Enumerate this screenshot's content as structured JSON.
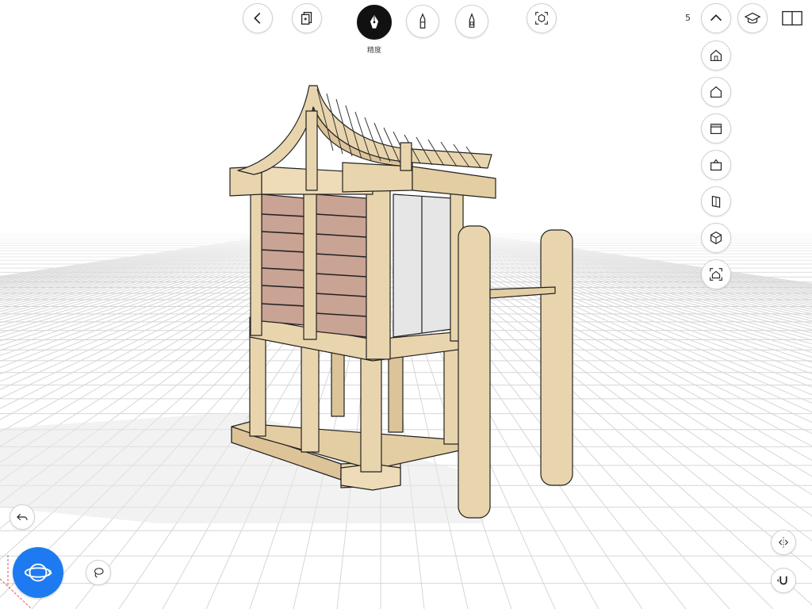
{
  "toolbar": {
    "active_tool_label": "精度",
    "layer_count": "5"
  },
  "colors": {
    "accent": "#1e7af0",
    "wood": "#e9d5ad",
    "wall": "#c9a394",
    "glass": "#e6e6e6",
    "grid": "#d8d8d8"
  },
  "icons": {
    "back": "chevron-left-icon",
    "pages": "pages-icon",
    "pen_precision": "fountain-pen-icon",
    "pen_marker": "marker-pen-icon",
    "pen_brush": "brush-pen-icon",
    "fit": "fit-view-icon",
    "collapse": "chevron-up-icon",
    "learn": "graduation-cap-icon",
    "panel": "panel-icon",
    "view_front": "front-view-icon",
    "view_side": "side-view-icon",
    "view_top": "top-view-icon",
    "view_bottom": "bottom-view-icon",
    "view_left": "left-view-icon",
    "view_iso": "cube-icon",
    "view_home": "home-frame-icon",
    "undo": "undo-icon",
    "lasso": "lasso-icon",
    "orbit": "orbit-icon",
    "mirror": "mirror-icon",
    "magnet": "magnet-icon"
  }
}
